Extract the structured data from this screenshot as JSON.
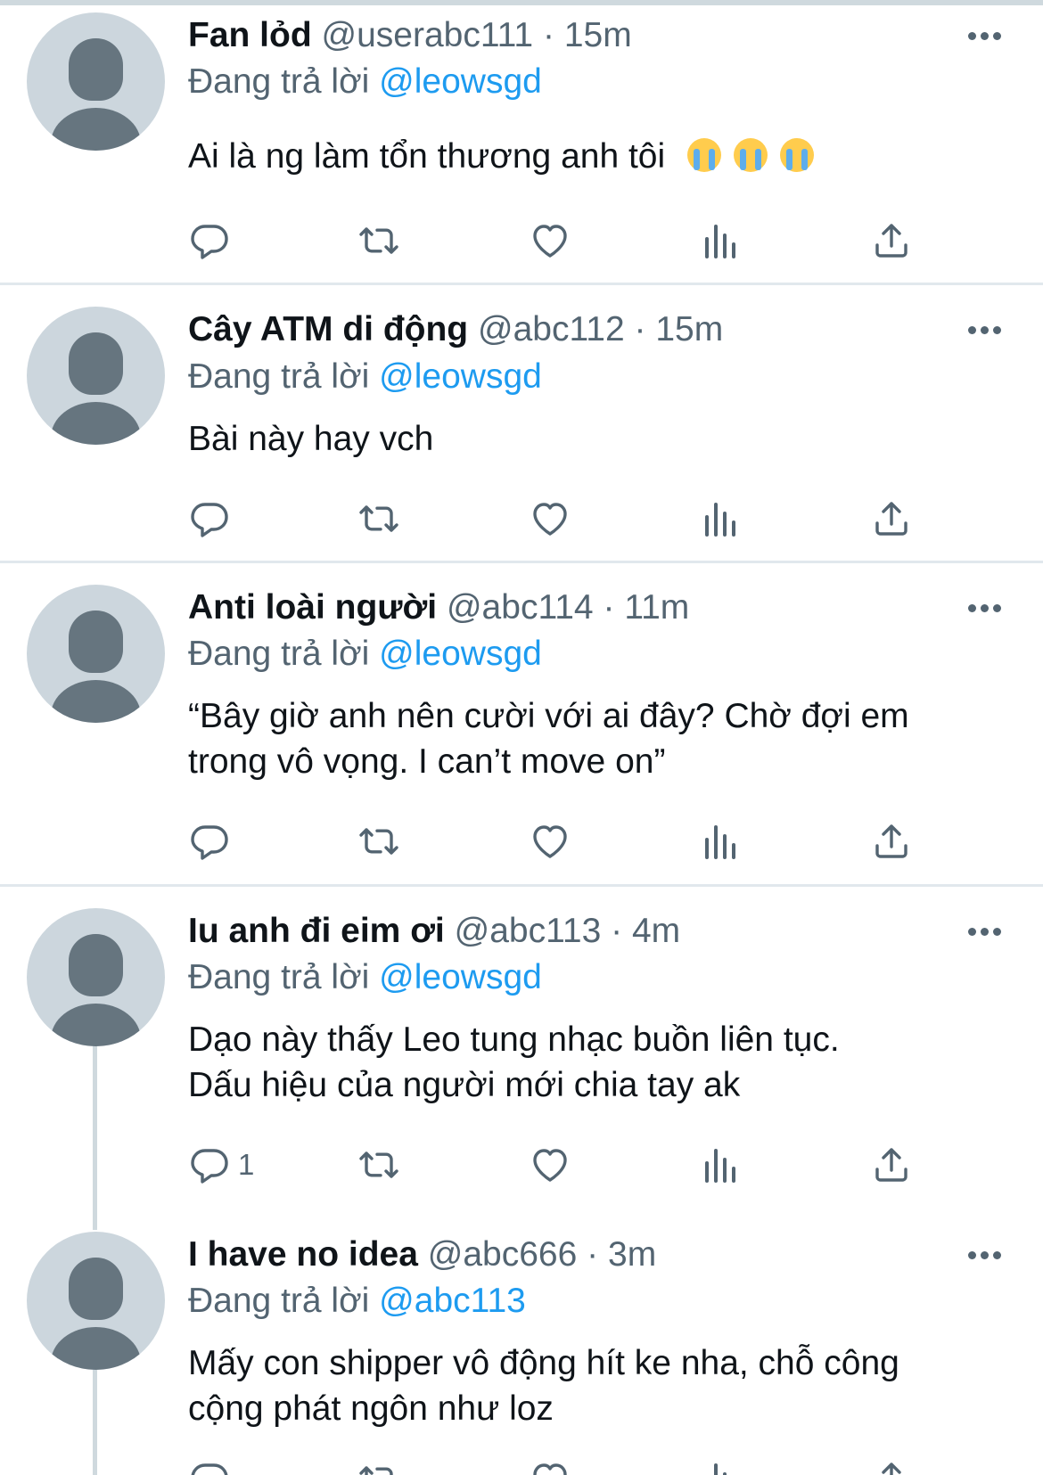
{
  "colors": {
    "link": "#1d9bf0",
    "secondary": "#536471",
    "separator": "#e1e8ed",
    "avatar_bg": "#ccd6dd"
  },
  "icons": [
    "reply-icon",
    "retweet-icon",
    "like-icon",
    "analytics-icon",
    "share-icon",
    "more-icon"
  ],
  "tweets": [
    {
      "name": "Fan lỏd",
      "handle": "@userabc111",
      "dot": "·",
      "time": "15m",
      "replying_prefix": "Đang trả lời",
      "replying_to": "@leowsgd",
      "text": "Ai là ng làm tổn thương anh tôi",
      "emoji": "loudly-crying-face ×3",
      "reply_count": ""
    },
    {
      "name": "Cây ATM di động",
      "handle": "@abc112",
      "dot": "·",
      "time": "15m",
      "replying_prefix": "Đang trả lời",
      "replying_to": "@leowsgd",
      "text": "Bài này hay vch",
      "reply_count": ""
    },
    {
      "name": "Anti loài người",
      "handle": "@abc114",
      "dot": "·",
      "time": "11m",
      "replying_prefix": "Đang trả lời",
      "replying_to": "@leowsgd",
      "text_line1": "“Bây giờ anh nên cười với ai đây? Chờ đợi em",
      "text_line2": "trong vô vọng. I can’t move on”",
      "reply_count": ""
    },
    {
      "name": "Iu anh đi eim ơi",
      "handle": "@abc113",
      "dot": "·",
      "time": "4m",
      "replying_prefix": "Đang trả lời",
      "replying_to": "@leowsgd",
      "text_line1": "Dạo này thấy Leo tung nhạc buồn liên tục.",
      "text_line2": "Dấu hiệu của người mới chia tay ak",
      "reply_count": "1"
    },
    {
      "name": "I have no idea",
      "handle": "@abc666",
      "dot": "·",
      "time": "3m",
      "replying_prefix": "Đang trả lời",
      "replying_to": "@abc113",
      "text_line1": "Mấy con shipper vô động hít ke nha, chỗ công",
      "text_line2": "cộng phát ngôn như loz",
      "reply_count": ""
    }
  ]
}
